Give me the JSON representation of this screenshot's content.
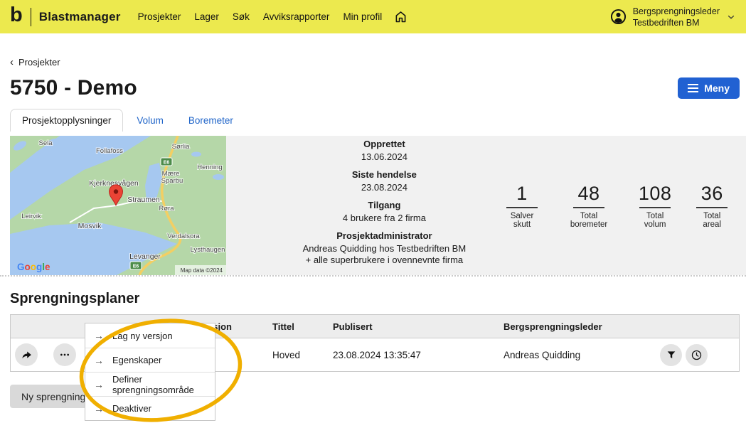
{
  "topbar": {
    "logo_glyph": "b",
    "brand": "Blastmanager",
    "nav": [
      "Prosjekter",
      "Lager",
      "Søk",
      "Avviksrapporter",
      "Min profil"
    ],
    "user": {
      "role": "Bergsprengningsleder",
      "company": "Testbedriften BM"
    }
  },
  "breadcrumb": {
    "chevron": "‹",
    "label": "Prosjekter"
  },
  "page": {
    "title": "5750 - Demo",
    "menu_button": "Meny"
  },
  "tabs": [
    "Prosjektopplysninger",
    "Volum",
    "Boremeter"
  ],
  "map": {
    "labels": [
      "Sela",
      "Follafoss",
      "Sørlia",
      "Henning",
      "Mære",
      "Sparbu",
      "Kjerknesvågen",
      "Straumen",
      "Røra",
      "Leirvik",
      "Mosvik",
      "Verdalsora",
      "Lysthaugen",
      "Levanger"
    ],
    "road_badge": "E6",
    "google_letters": [
      "G",
      "o",
      "o",
      "g",
      "l",
      "e"
    ],
    "attribution": "Map data ©2024"
  },
  "details": {
    "fields": [
      {
        "label": "Opprettet",
        "value": "13.06.2024"
      },
      {
        "label": "Siste hendelse",
        "value": "23.08.2024"
      },
      {
        "label": "Tilgang",
        "value": "4 brukere fra 2 firma"
      },
      {
        "label": "Prosjektadministrator",
        "value": "Andreas Quidding hos Testbedriften BM",
        "value2": "+ alle superbrukere i ovennevnte firma"
      }
    ]
  },
  "stats": [
    {
      "value": "1",
      "label": "Salver skutt"
    },
    {
      "value": "48",
      "label": "Total boremeter"
    },
    {
      "value": "108",
      "label": "Total volum"
    },
    {
      "value": "36",
      "label": "Total areal"
    }
  ],
  "section": {
    "title": "Sprengningsplaner",
    "new_button_label": "Ny sprengningsplan"
  },
  "table": {
    "columns": [
      "Versjon",
      "Tittel",
      "Publisert",
      "Bergsprengningsleder"
    ],
    "rows": [
      {
        "versjon": "",
        "tittel": "Hoved",
        "publisert": "23.08.2024 13:35:47",
        "bergsprengningsleder": "Andreas Quidding"
      }
    ]
  },
  "context_menu": {
    "arrow": "→",
    "items": [
      "Lag ny versjon",
      "Egenskaper",
      "Definer sprengningsområde",
      "Deaktiver"
    ]
  },
  "colors": {
    "topbar_yellow": "#ECE94E",
    "accent_blue": "#2161D2",
    "annotation_yellow": "#F0AF00"
  }
}
